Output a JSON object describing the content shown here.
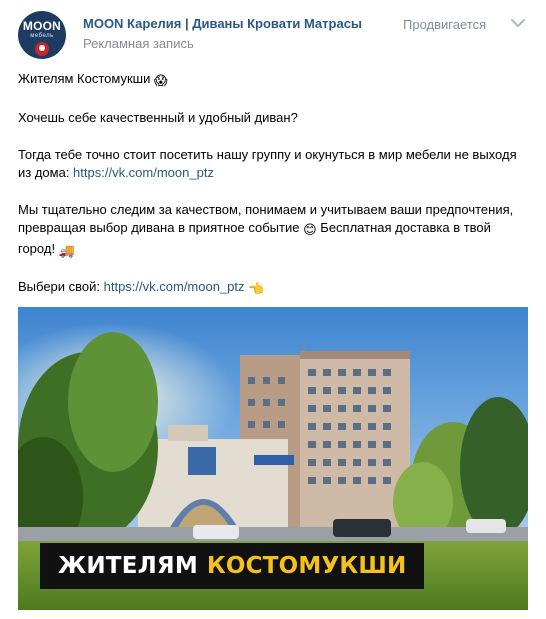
{
  "post": {
    "group_name": "MOON Карелия | Диваны Кровати Матрасы",
    "ad_label": "Рекламная запись",
    "promoted_label": "Продвигается",
    "avatar": {
      "brand": "MOON",
      "subtitle": "мебель"
    }
  },
  "text": {
    "line1": "Жителям Костомукши",
    "line1_emoji": "😱",
    "line2": "Хочешь себе качественный и удобный диван?",
    "line3_a": "Тогда тебе точно стоит посетить нашу группу и окунуться в мир мебели не выходя",
    "line3_b": "из дома: ",
    "link1": "https://vk.com/moon_ptz",
    "line4_a": "Мы тщательно следим за качеством, понимаем и учитываем ваши предпочтения,",
    "line4_b": "превращая выбор дивана в приятное событие",
    "smile_emoji": "😊",
    "line4_c": " Бесплатная доставка в твой",
    "line4_d": "город!",
    "truck_emoji": "🚚",
    "line5": "Выбери свой: ",
    "link2": "https://vk.com/moon_ptz",
    "point_emoji": "👈"
  },
  "image": {
    "banner_white": "ЖИТЕЛЯМ",
    "banner_yellow": "КОСТОМУКШИ"
  },
  "colors": {
    "link": "#2a5885",
    "muted": "#818c99",
    "banner_bg": "#111111",
    "banner_accent": "#f5c21b"
  }
}
